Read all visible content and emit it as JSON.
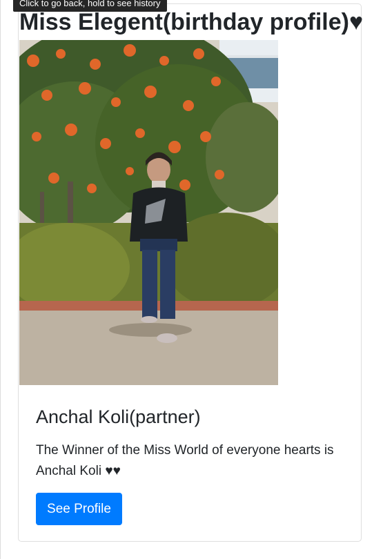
{
  "tooltip": {
    "text": "Click to go back, hold to see history"
  },
  "card": {
    "heading": "Miss Elegent(birthday profile)♥",
    "photo": {
      "icon": "profile-photo"
    },
    "name": "Anchal Koli(partner)",
    "description": "The Winner of the Miss World of everyone hearts is Anchal Koli ♥♥",
    "button_label": "See Profile"
  },
  "colors": {
    "button_bg": "#007bff",
    "button_text": "#ffffff",
    "text": "#212529",
    "tooltip_bg": "#262626"
  }
}
